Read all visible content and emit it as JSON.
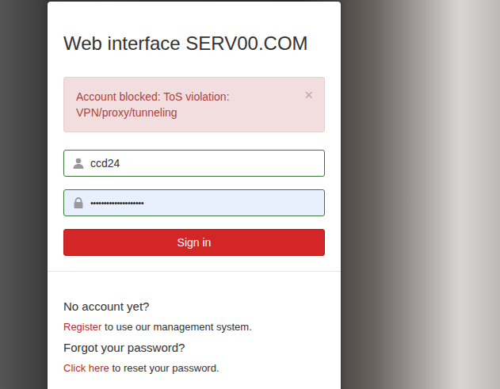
{
  "title": "Web interface SERV00.COM",
  "alert": {
    "message": "Account blocked: ToS violation: VPN/proxy/tunneling",
    "close": "×"
  },
  "fields": [
    {
      "kind": "username",
      "value": "ccd24",
      "valid": true,
      "autofilled": false
    },
    {
      "kind": "password",
      "value": "••••••••••••••••••••",
      "valid": true,
      "autofilled": true
    }
  ],
  "submit": "Sign in",
  "help": [
    {
      "question": "No account yet?",
      "link": "Register",
      "rest": "to use our management system."
    },
    {
      "question": "Forgot your password?",
      "link": "Click here",
      "rest": "to reset your password."
    }
  ]
}
